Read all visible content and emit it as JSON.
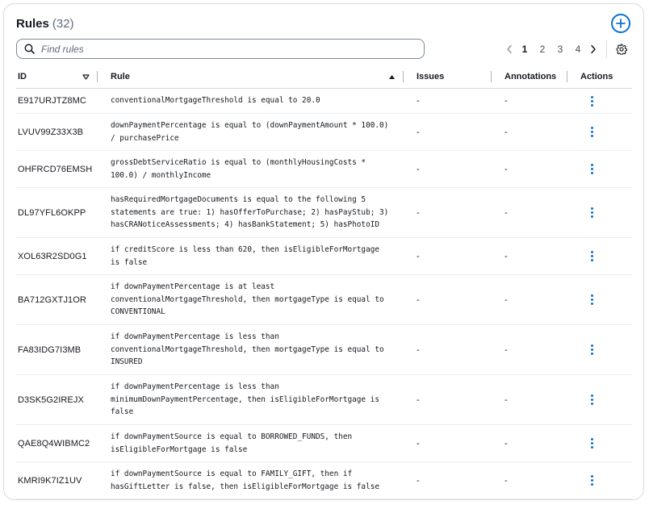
{
  "header": {
    "title": "Rules",
    "count": "(32)"
  },
  "search": {
    "placeholder": "Find rules",
    "value": ""
  },
  "pagination": {
    "pages": [
      "1",
      "2",
      "3",
      "4"
    ],
    "current": "1"
  },
  "columns": {
    "id": "ID",
    "rule": "Rule",
    "issues": "Issues",
    "annotations": "Annotations",
    "actions": "Actions"
  },
  "colors": {
    "accent": "#0972d3",
    "border": "#d5dbdb",
    "text": "#16191f"
  },
  "rows": [
    {
      "id": "E917URJTZ8MC",
      "rule": "conventionalMortgageThreshold is equal to 20.0",
      "issues": "-",
      "annotations": "-"
    },
    {
      "id": "LVUV99Z33X3B",
      "rule": "downPaymentPercentage is equal to (downPaymentAmount * 100.0) / purchasePrice",
      "issues": "-",
      "annotations": "-"
    },
    {
      "id": "OHFRCD76EMSH",
      "rule": "grossDebtServiceRatio is equal to (monthlyHousingCosts * 100.0) / monthlyIncome",
      "issues": "-",
      "annotations": "-"
    },
    {
      "id": "DL97YFL6OKPP",
      "rule": "hasRequiredMortgageDocuments is equal to the following 5 statements are true: 1) hasOfferToPurchase; 2) hasPayStub; 3) hasCRANoticeAssessments; 4) hasBankStatement; 5) hasPhotoID",
      "issues": "-",
      "annotations": "-"
    },
    {
      "id": "XOL63R2SD0G1",
      "rule": "if creditScore is less than 620, then isEligibleForMortgage is false",
      "issues": "-",
      "annotations": "-"
    },
    {
      "id": "BA712GXTJ1OR",
      "rule": "if downPaymentPercentage is at least conventionalMortgageThreshold, then mortgageType is equal to CONVENTIONAL",
      "issues": "-",
      "annotations": "-"
    },
    {
      "id": "FA83IDG7I3MB",
      "rule": "if downPaymentPercentage is less than conventionalMortgageThreshold, then mortgageType is equal to INSURED",
      "issues": "-",
      "annotations": "-"
    },
    {
      "id": "D3SK5G2IREJX",
      "rule": "if downPaymentPercentage is less than minimumDownPaymentPercentage, then isEligibleForMortgage is false",
      "issues": "-",
      "annotations": "-"
    },
    {
      "id": "QAE8Q4WIBMC2",
      "rule": "if downPaymentSource is equal to BORROWED_FUNDS, then isEligibleForMortgage is false",
      "issues": "-",
      "annotations": "-"
    },
    {
      "id": "KMRI9K7IZ1UV",
      "rule": "if downPaymentSource is equal to FAMILY_GIFT, then if hasGiftLetter is false, then isEligibleForMortgage is false",
      "issues": "-",
      "annotations": "-"
    }
  ]
}
